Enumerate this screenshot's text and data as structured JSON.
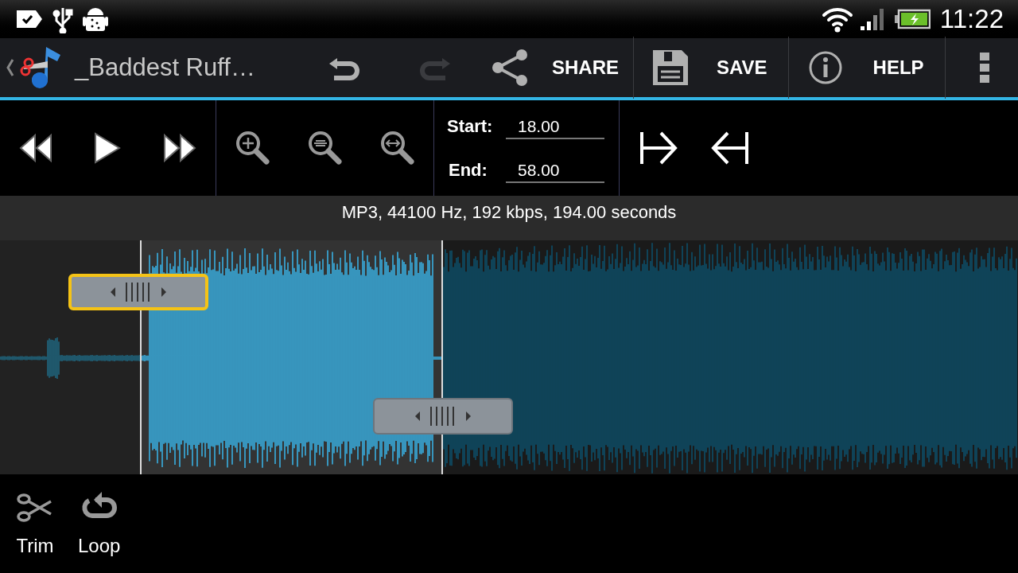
{
  "status_bar": {
    "time": "11:22"
  },
  "action_bar": {
    "title": "_Baddest Ruff…",
    "actions": [
      {
        "kind": "undo",
        "disabled": false
      },
      {
        "kind": "redo",
        "disabled": true
      },
      {
        "kind": "share",
        "label": "SHARE",
        "disabled": false
      },
      {
        "kind": "save",
        "label": "SAVE",
        "disabled": false
      },
      {
        "kind": "help",
        "label": "HELP",
        "disabled": false
      },
      {
        "kind": "overflow",
        "disabled": false
      }
    ]
  },
  "controls": {
    "start_label": "Start:",
    "start_value": "18.00",
    "end_label": "End:",
    "end_value": "58.00"
  },
  "info": "MP3, 44100 Hz, 192 kbps, 194.00 seconds",
  "handles": [
    {
      "kind": "start",
      "selected": true
    },
    {
      "kind": "end",
      "selected": false
    }
  ],
  "bottom_actions": [
    {
      "kind": "trim",
      "label": "Trim"
    },
    {
      "kind": "loop",
      "label": "Loop"
    }
  ]
}
